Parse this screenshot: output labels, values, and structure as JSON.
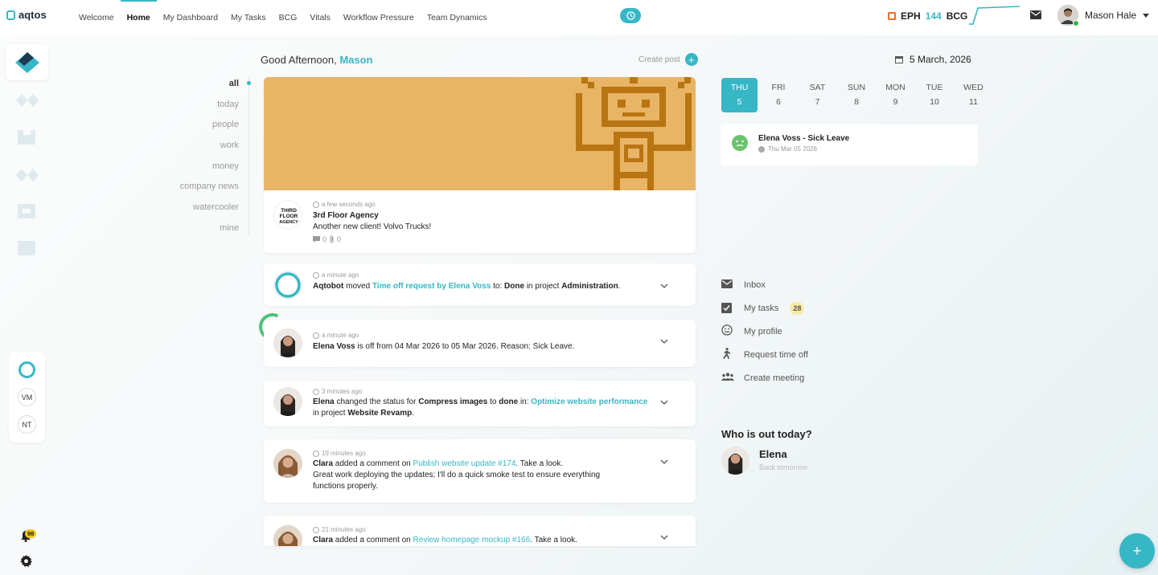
{
  "app": {
    "logo_text": "aqtos"
  },
  "nav": {
    "links": [
      "Welcome",
      "Home",
      "My Dashboard",
      "My Tasks",
      "BCG",
      "Vitals",
      "Workflow Pressure",
      "Team Dynamics"
    ],
    "active": "Home"
  },
  "header": {
    "eph_label": "EPH",
    "eph_value": "144",
    "eph_unit": "BCG",
    "user_name": "Mason Hale"
  },
  "rail": {
    "initials": [
      "VM",
      "NT"
    ],
    "notifications": "98"
  },
  "greeting": {
    "prefix": "Good Afternoon,",
    "name": "Mason"
  },
  "create_post": "Create post",
  "filters": [
    "all",
    "today",
    "people",
    "work",
    "money",
    "company news",
    "watercooler",
    "mine"
  ],
  "feed": {
    "post": {
      "time": "a few seconds ago",
      "avatar_text": "THIRD FLOOR AGENCY",
      "author": "3rd Floor Agency",
      "text": "Another new client! Volvo Trucks!",
      "comments": "0",
      "attachments": "0"
    },
    "items": [
      {
        "time": "a minute ago",
        "actor": "Aqtobot",
        "verb": "moved",
        "link": "Time off request by Elena Voss",
        "mid": "to:",
        "status": "Done",
        "mid2": "in project",
        "project": "Administration",
        "end": "."
      },
      {
        "time": "a minute ago",
        "actor": "Elena Voss",
        "text": "is off from 04 Mar 2026 to 05 Mar 2026. Reason: Sick Leave."
      },
      {
        "time": "3 minutes ago",
        "actor": "Elena",
        "verb": "changed the status for",
        "task": "Compress images",
        "mid": "to",
        "status": "done",
        "mid2": "in:",
        "link": "Optimize website performance",
        "line2_pre": "in project",
        "project": "Website Revamp",
        "end": "."
      },
      {
        "time": "19 minutes ago",
        "actor": "Clara",
        "verb": "added a comment on",
        "link": "Publish website update #174",
        "end": ". Take a look.",
        "line2": "Great work deploying the updates; I'll do a quick smoke test to ensure everything",
        "line3": "functions properly."
      },
      {
        "time": "21 minutes ago",
        "actor": "Clara",
        "verb": "added a comment on",
        "link": "Review homepage mockup #166",
        "end": ". Take a look."
      }
    ]
  },
  "calendar": {
    "date": "5 March, 2026",
    "days": [
      {
        "name": "THU",
        "num": "5",
        "active": true
      },
      {
        "name": "FRI",
        "num": "6"
      },
      {
        "name": "SAT",
        "num": "7"
      },
      {
        "name": "SUN",
        "num": "8"
      },
      {
        "name": "MON",
        "num": "9"
      },
      {
        "name": "TUE",
        "num": "10"
      },
      {
        "name": "WED",
        "num": "11"
      }
    ],
    "event": {
      "title": "Elena Voss - Sick Leave",
      "date": "Thu Mar 05 2026"
    }
  },
  "quick_links": {
    "inbox": "Inbox",
    "my_tasks": "My tasks",
    "my_tasks_count": "28",
    "my_profile": "My profile",
    "request_time_off": "Request time off",
    "create_meeting": "Create meeting"
  },
  "out_today": {
    "title": "Who is out today?",
    "name": "Elena",
    "sub": "Back tomorrow"
  },
  "colors": {
    "accent": "#37b7c6",
    "banner": "#e8b466",
    "robot": "#b97512",
    "badge": "#f5c518"
  }
}
